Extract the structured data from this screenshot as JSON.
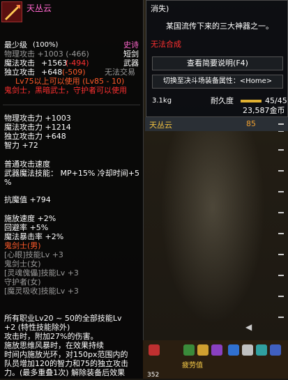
{
  "item": {
    "name": "天丛云",
    "level_req": "最少级",
    "durability_pct": "(100%)",
    "rarity": "史诗",
    "type1": "短剑",
    "type2": "武器",
    "trade": "无法交易",
    "phys_atk": "物理攻击 +1003 (-466)",
    "mag_atk_label": "魔法攻击",
    "mag_atk_val": "+1563",
    "mag_atk_diff": "(-494)",
    "indep_label": "独立攻击",
    "indep_val": "+648",
    "indep_diff": "(-509)",
    "level_line": "Lv75以上可以使用 (Lv85 - 10)",
    "class_line": "鬼剑士，黑暗武士，守护者可以使用",
    "stats": [
      "物理攻击力 +1003",
      "魔法攻击力 +1214",
      "独立攻击力 +648",
      "智力 +72"
    ],
    "speed_label": "普通攻击速度",
    "skill_label": "武器魔法技能： MP+15% 冷却时间+5",
    "skill_label2": "%",
    "magic_res": "抗魔值 +794",
    "speed_stats": [
      "施放速度 +2%",
      "回避率 +5%",
      "魔法暴击率 +2%"
    ],
    "class_skills": [
      "鬼剑士(男)",
      "[心眼]技能Lv +3",
      "鬼剑士(女)",
      "[灵魂傀儡]技能Lv +3",
      "守护者(女)",
      "[魔灵吸收]技能Lv +3"
    ],
    "desc": [
      "所有职业Lv20 ~ 50的全部技能Lv",
      "+2 (特性技能除外)",
      "  攻击时，附加27%的伤害。",
      "  施放思维风暴时，在效果持续",
      "时间内施放光环，对150px范围内的",
      "队员增加120的智力和75的独立攻击",
      "力。(最多重叠1次) 解除装备后效果"
    ]
  },
  "right_panel": {
    "header": "消失)",
    "lore": "某国流传下来的三大神器之一。",
    "no_compose": "无法合成",
    "btn_desc": "查看简要说明(F4)",
    "btn_switch": "切换至决斗场装备属性：<Home>",
    "weight": "3.1kg",
    "dur_label": "耐久度",
    "dur_val": "45/45",
    "price": "23,587金币"
  },
  "list": {
    "selected_name": "天丛云",
    "selected_level": "85"
  },
  "hotbar": {
    "exp_label": "疲劳值",
    "num": "352"
  }
}
